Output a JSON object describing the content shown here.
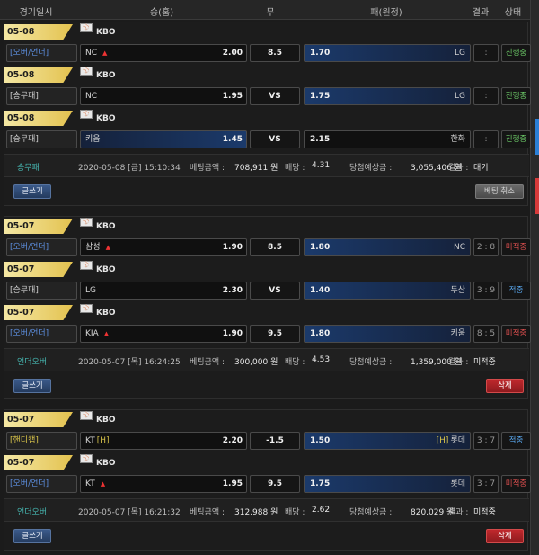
{
  "header": {
    "date_time": "경기일시",
    "home": "승(홈)",
    "draw": "무",
    "away": "패(원정)",
    "result": "결과",
    "status": "상태"
  },
  "colors": {
    "accent_gold": "#e3c24f",
    "selected_blue": "#1b3a6b",
    "delete_red": "#c0282d",
    "progress_green": "#6fcf6a"
  },
  "slips": [
    {
      "games": [
        {
          "date": "05-08 [금]18:30",
          "league": "KBO",
          "type": "[오버/언더]",
          "home": "NC",
          "home_odds": "2.00",
          "home_arrow": true,
          "mid": "8.5",
          "away_odds": "1.70",
          "away": "LG",
          "score": ":",
          "status": "진행중",
          "sel": "away"
        },
        {
          "date": "05-08 [금]18:30",
          "league": "KBO",
          "type": "[승무패]",
          "home": "NC",
          "home_odds": "1.95",
          "home_arrow": false,
          "mid": "VS",
          "away_odds": "1.75",
          "away": "LG",
          "score": ":",
          "status": "진행중",
          "sel": "away"
        },
        {
          "date": "05-08 [금]18:30",
          "league": "KBO",
          "type": "[승무패]",
          "home": "키움",
          "home_odds": "1.45",
          "home_arrow": false,
          "mid": "VS",
          "away_odds": "2.15",
          "away": "한화",
          "score": ":",
          "status": "진행중",
          "sel": "home"
        }
      ],
      "summary": {
        "bet_type": "승무패",
        "datetime": "2020-05-08 [금] 15:10:34",
        "amount_label": "베팅금액 :",
        "amount": "708,911 원",
        "odds_label": "배당 :",
        "odds": "4.31",
        "win_label": "당첨예상금 :",
        "win": "3,055,406 원",
        "result_label": "결과 :",
        "result": "대기"
      },
      "write_label": "글쓰기",
      "action_label": "베팅 취소"
    },
    {
      "games": [
        {
          "date": "05-07 [목]18:30",
          "league": "KBO",
          "type": "[오버/언더]",
          "home": "삼성",
          "home_odds": "1.90",
          "home_arrow": true,
          "mid": "8.5",
          "away_odds": "1.80",
          "away": "NC",
          "score": "2 : 8",
          "status": "미적중",
          "sel": "away"
        },
        {
          "date": "05-07 [목]18:30",
          "league": "KBO",
          "type": "[승무패]",
          "home": "LG",
          "home_odds": "2.30",
          "home_arrow": false,
          "mid": "VS",
          "away_odds": "1.40",
          "away": "두산",
          "score": "3 : 9",
          "status": "적중",
          "sel": "away"
        },
        {
          "date": "05-07 [목]18:30",
          "league": "KBO",
          "type": "[오버/언더]",
          "home": "KIA",
          "home_odds": "1.90",
          "home_arrow": true,
          "mid": "9.5",
          "away_odds": "1.80",
          "away": "키움",
          "score": "8 : 5",
          "status": "미적중",
          "sel": "away"
        }
      ],
      "summary": {
        "bet_type": "언더오버",
        "datetime": "2020-05-07 [목] 16:24:25",
        "amount_label": "베팅금액 :",
        "amount": "300,000 원",
        "odds_label": "배당 :",
        "odds": "4.53",
        "win_label": "당첨예상금 :",
        "win": "1,359,000 원",
        "result_label": "결과 :",
        "result": "미적중"
      },
      "write_label": "글쓰기",
      "action_label": "삭제"
    },
    {
      "games": [
        {
          "date": "05-07 [목]18:30",
          "league": "KBO",
          "type": "[핸디캡]",
          "home": "KT",
          "home_h": "[H]",
          "home_odds": "2.20",
          "home_arrow": false,
          "mid": "-1.5",
          "away_odds": "1.50",
          "away": "롯데",
          "away_h": "[H]",
          "score": "3 : 7",
          "status": "적중",
          "sel": "away"
        },
        {
          "date": "05-07 [목]18:30",
          "league": "KBO",
          "type": "[오버/언더]",
          "home": "KT",
          "home_odds": "1.95",
          "home_arrow": true,
          "mid": "9.5",
          "away_odds": "1.75",
          "away": "롯데",
          "score": "3 : 7",
          "status": "미적중",
          "sel": "away"
        }
      ],
      "summary": {
        "bet_type": "언더오버",
        "datetime": "2020-05-07 [목] 16:21:32",
        "amount_label": "베팅금액 :",
        "amount": "312,988 원",
        "odds_label": "배당 :",
        "odds": "2.62",
        "win_label": "당첨예상금 :",
        "win": "820,029 원",
        "result_label": "결과 :",
        "result": "미적중"
      },
      "write_label": "글쓰기",
      "action_label": "삭제"
    }
  ]
}
